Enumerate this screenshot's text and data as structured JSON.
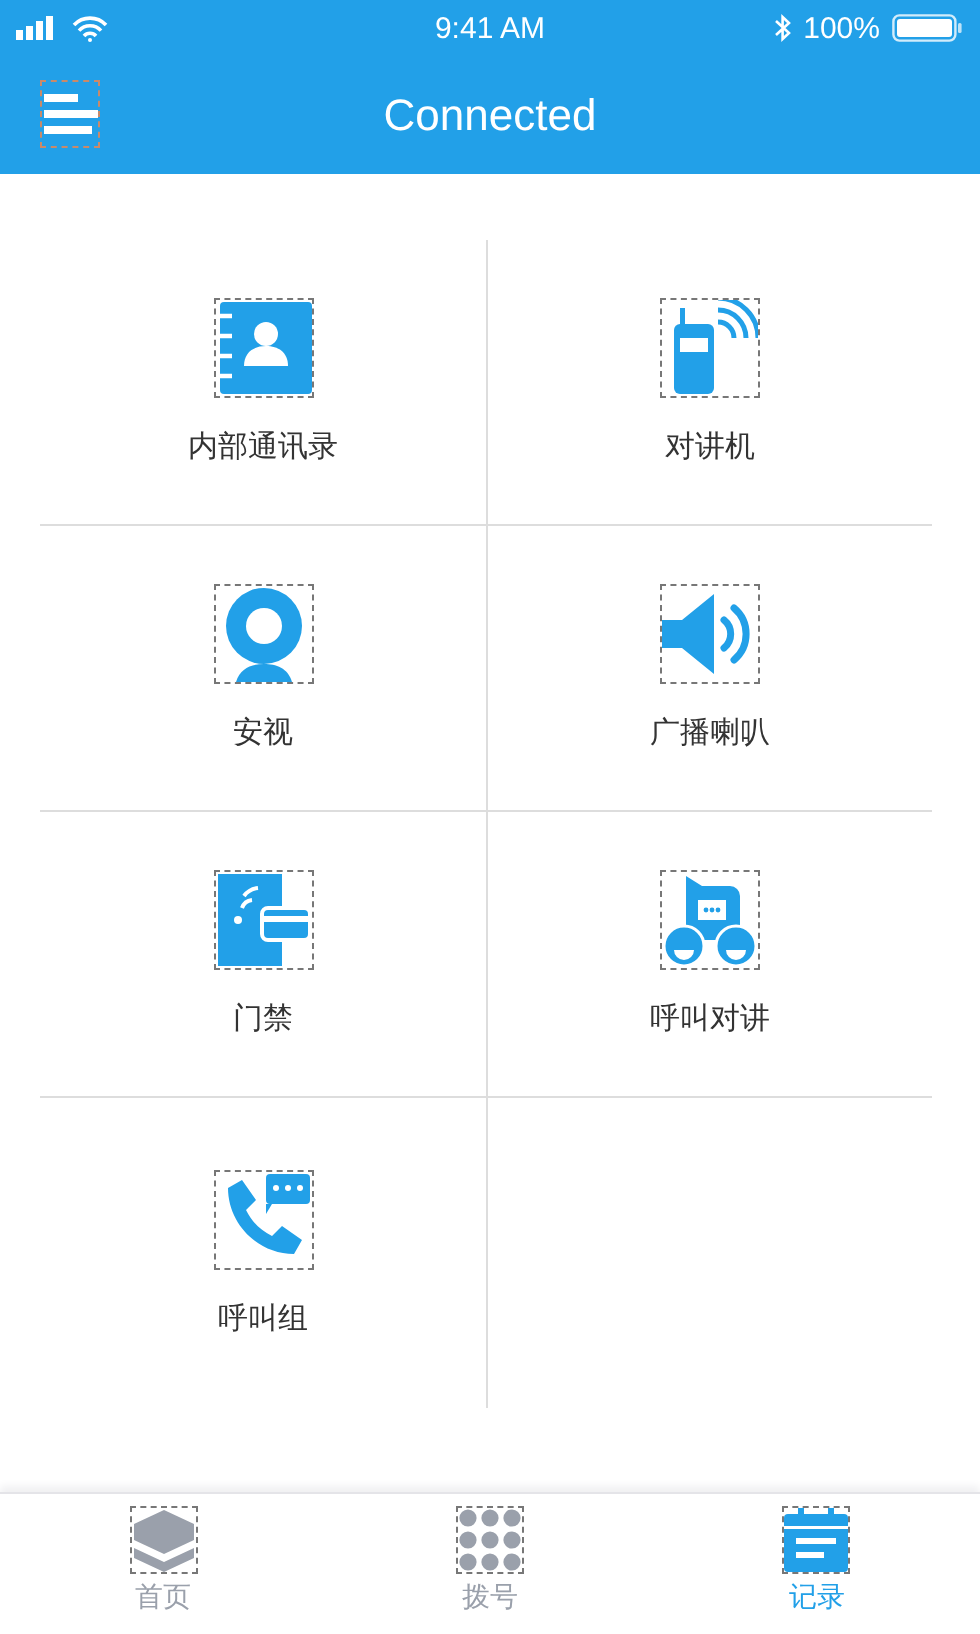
{
  "status_bar": {
    "time": "9:41 AM",
    "battery": "100%"
  },
  "header": {
    "title": "Connected"
  },
  "grid": [
    {
      "label": "内部通讯录"
    },
    {
      "label": "对讲机"
    },
    {
      "label": "安视"
    },
    {
      "label": "广播喇叭"
    },
    {
      "label": "门禁"
    },
    {
      "label": "呼叫对讲"
    },
    {
      "label": "呼叫组"
    }
  ],
  "tabs": [
    {
      "label": "首页",
      "selected": false
    },
    {
      "label": "拨号",
      "selected": false
    },
    {
      "label": "记录",
      "selected": true
    }
  ]
}
